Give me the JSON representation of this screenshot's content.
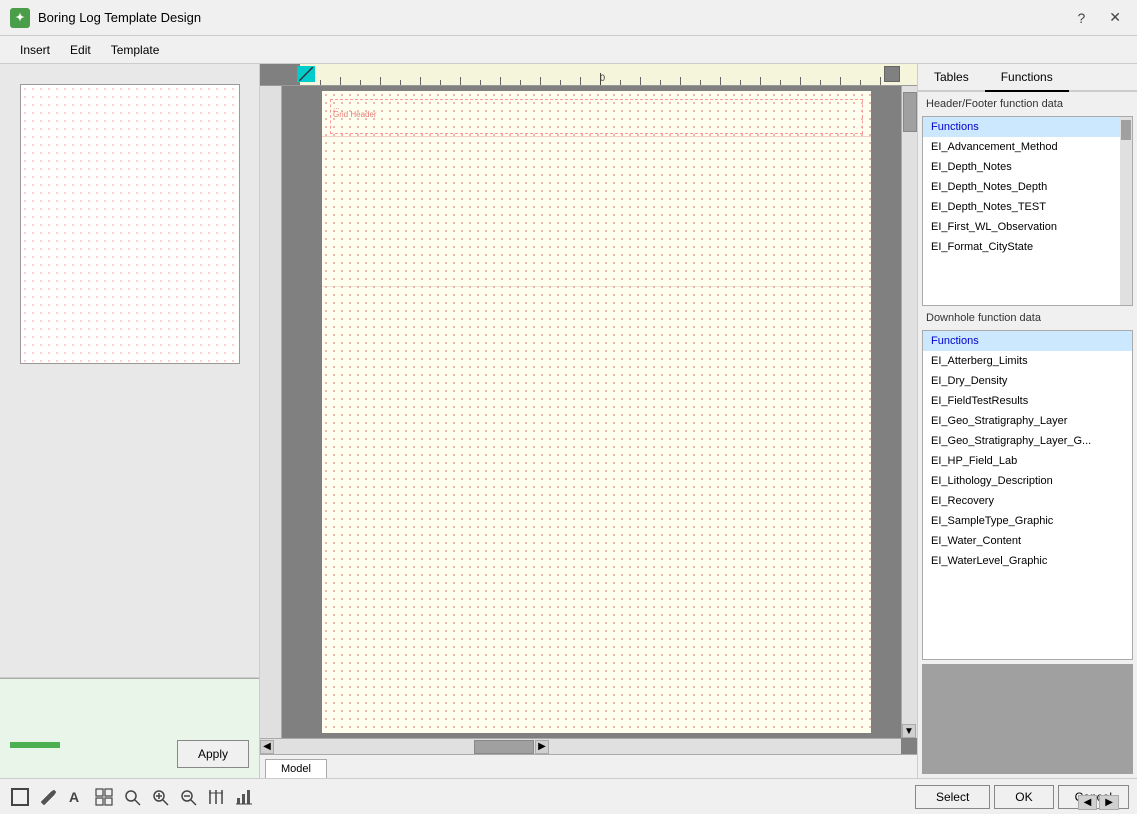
{
  "window": {
    "title": "Boring Log Template Design",
    "help_btn": "?",
    "close_btn": "✕"
  },
  "menu": {
    "items": [
      "Insert",
      "Edit",
      "Template"
    ]
  },
  "tabs": {
    "tables_label": "Tables",
    "functions_label": "Functions"
  },
  "header_footer": {
    "section_label": "Header/Footer function data",
    "items": [
      {
        "label": "Functions",
        "selected": true
      },
      {
        "label": "EI_Advancement_Method"
      },
      {
        "label": "EI_Depth_Notes"
      },
      {
        "label": "EI_Depth_Notes_Depth"
      },
      {
        "label": "EI_Depth_Notes_TEST"
      },
      {
        "label": "EI_First_WL_Observation"
      },
      {
        "label": "EI_Format_CityState"
      }
    ]
  },
  "downhole": {
    "section_label": "Downhole function data",
    "items": [
      {
        "label": "Functions",
        "selected": true
      },
      {
        "label": "EI_Atterberg_Limits"
      },
      {
        "label": "EI_Dry_Density"
      },
      {
        "label": "EI_FieldTestResults"
      },
      {
        "label": "EI_Geo_Stratigraphy_Layer"
      },
      {
        "label": "EI_Geo_Stratigraphy_Layer_G..."
      },
      {
        "label": "EI_HP_Field_Lab"
      },
      {
        "label": "EI_Lithology_Description"
      },
      {
        "label": "EI_Recovery"
      },
      {
        "label": "EI_SampleType_Graphic"
      },
      {
        "label": "EI_Water_Content"
      },
      {
        "label": "EI_WaterLevel_Graphic"
      }
    ]
  },
  "canvas_tab": {
    "model_label": "Model"
  },
  "toolbar": {
    "apply_label": "Apply",
    "select_label": "Select",
    "ok_label": "OK",
    "cancel_label": "Cancel"
  },
  "ruler": {
    "marker_0": "0"
  }
}
